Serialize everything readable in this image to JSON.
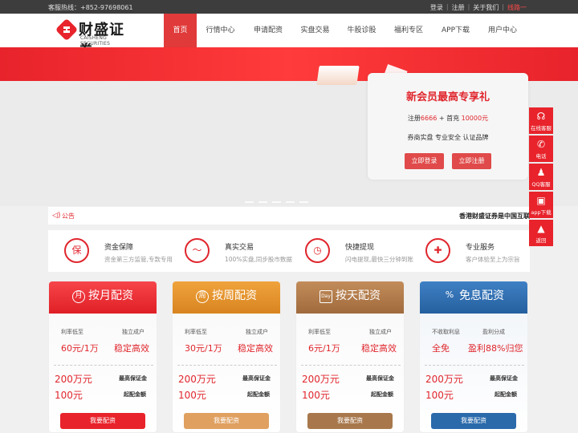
{
  "topbar": {
    "hotline": "客服热线：+852-97698061",
    "links": [
      "登录",
      "注册",
      "关于我们",
      "线路一"
    ]
  },
  "logo": {
    "name": "财盛证券",
    "en": "CAISHENG SECURITIES"
  },
  "nav": [
    "首页",
    "行情中心",
    "申请配资",
    "实盘交易",
    "牛股诊股",
    "福利专区",
    "APP下载",
    "用户中心"
  ],
  "promo": {
    "title": "新会员最高专享礼",
    "offer_prefix": "注册",
    "offer_reg": "6666",
    "offer_mid": " + 首充 ",
    "offer_charge": "10000元",
    "slogan": "券商实盘 专业安全 认证品牌",
    "login_label": "立即登录",
    "register_label": "立即注册"
  },
  "notice": {
    "label": "公告",
    "text": "香港财盛证券是中国互联"
  },
  "features": [
    {
      "title": "资金保障",
      "desc": "资金第三方监管,专款专用",
      "icon": "shield-icon",
      "glyph": "保"
    },
    {
      "title": "真实交易",
      "desc": "100%实盘,同步股市数据",
      "icon": "trend-icon",
      "glyph": "〜"
    },
    {
      "title": "快捷提现",
      "desc": "闪电提现,最快三分钟到账",
      "icon": "clock-icon",
      "glyph": "◷"
    },
    {
      "title": "专业服务",
      "desc": "客户体验至上为宗旨",
      "icon": "thermometer-icon",
      "glyph": "✚"
    }
  ],
  "cards": [
    {
      "title": "按月配资",
      "icon_glyph": "月",
      "color": "#e8232b",
      "l1": "利率低至",
      "l2": "独立成户",
      "v1": "60元/1万",
      "v2": "稳定高效",
      "amt1": "200万元",
      "amt1_label": "最高保证金",
      "amt2": "100元",
      "amt2_label": "起配金额",
      "apply": "我要配资"
    },
    {
      "title": "按周配资",
      "icon_glyph": "周",
      "color": "#e0902a",
      "l1": "利率低至",
      "l2": "独立成户",
      "v1": "30元/1万",
      "v2": "稳定高效",
      "amt1": "200万元",
      "amt1_label": "最高保证金",
      "amt2": "100元",
      "amt2_label": "起配金额",
      "apply": "我要配资"
    },
    {
      "title": "按天配资",
      "icon_glyph": "Day",
      "color": "#b07a4c",
      "l1": "利率低至",
      "l2": "独立成户",
      "v1": "6元/1万",
      "v2": "稳定高效",
      "amt1": "200万元",
      "amt1_label": "最高保证金",
      "amt2": "100元",
      "amt2_label": "起配金额",
      "apply": "我要配资"
    },
    {
      "title": "免息配资",
      "icon_glyph": "%",
      "color": "#2f6fb3",
      "l1": "不收取利息",
      "l2": "盈利分成",
      "v1": "全免",
      "v2": "盈利88%归您",
      "amt1": "200万元",
      "amt1_label": "最高保证金",
      "amt2": "100元",
      "amt2_label": "起配金额",
      "apply": "我要配资"
    }
  ],
  "side": [
    {
      "label": "在线客服",
      "icon": "headset-icon",
      "glyph": "☊"
    },
    {
      "label": "电话",
      "icon": "phone-icon",
      "glyph": "✆"
    },
    {
      "label": "QQ客服",
      "icon": "qq-icon",
      "glyph": "♟"
    },
    {
      "label": "app下载",
      "icon": "app-icon",
      "glyph": "▣"
    },
    {
      "label": "返回",
      "icon": "back-top-icon",
      "glyph": "▲"
    }
  ]
}
